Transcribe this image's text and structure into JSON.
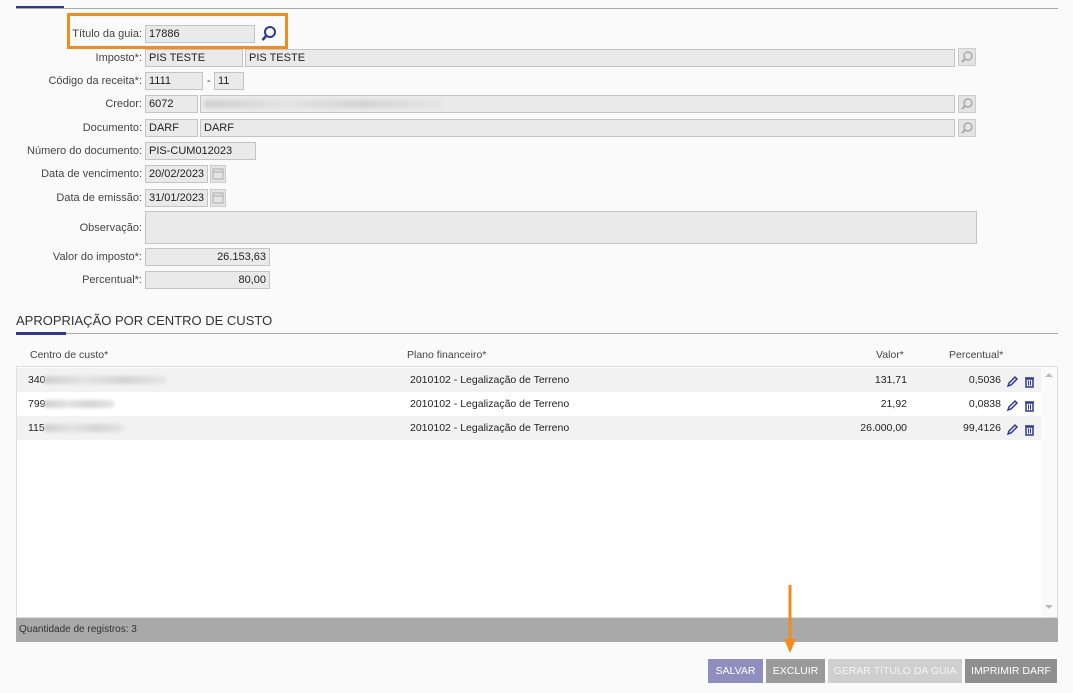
{
  "form": {
    "titulo_label": "Título da guia:",
    "titulo_value": "17886",
    "imposto_label": "Imposto*:",
    "imposto_code": "PIS TESTE",
    "imposto_desc": "PIS TESTE",
    "codigo_label": "Código da receita*:",
    "codigo_value": "1111",
    "codigo_sep": "-",
    "codigo_suffix": "11",
    "credor_label": "Credor:",
    "credor_code": "6072",
    "documento_label": "Documento:",
    "documento_code": "DARF",
    "documento_desc": "DARF",
    "numero_label": "Número do documento:",
    "numero_value": "PIS-CUM012023",
    "vencimento_label": "Data de vencimento:",
    "vencimento_value": "20/02/2023",
    "emissao_label": "Data de emissão:",
    "emissao_value": "31/01/2023",
    "observacao_label": "Observação:",
    "valor_label": "Valor do imposto*:",
    "valor_value": "26.153,63",
    "percentual_label": "Percentual*:",
    "percentual_value": "80,00"
  },
  "section": {
    "title": "APROPRIAÇÃO POR CENTRO DE CUSTO"
  },
  "table": {
    "headers": {
      "centro": "Centro de custo*",
      "plano": "Plano financeiro*",
      "valor": "Valor*",
      "percentual": "Percentual*"
    },
    "rows": [
      {
        "centro": "340",
        "plano": "2010102 - Legalização de Terreno",
        "valor": "131,71",
        "percentual": "0,5036"
      },
      {
        "centro": "799",
        "plano": "2010102 - Legalização de Terreno",
        "valor": "21,92",
        "percentual": "0,0838"
      },
      {
        "centro": "115",
        "plano": "2010102 - Legalização de Terreno",
        "valor": "26.000,00",
        "percentual": "99,4126"
      }
    ],
    "footer": "Quantidade de registros: 3"
  },
  "buttons": {
    "salvar": "SALVAR",
    "excluir": "EXCLUIR",
    "gerar": "GERAR TÍTULO DA GUIA",
    "imprimir": "IMPRIMIR DARF"
  },
  "colors": {
    "accent": "#2f3a8f",
    "highlight": "#f28c1e",
    "salvar": "#8e8ebf",
    "excluir": "#9a9a9a",
    "gerar": "#cfcfcf",
    "imprimir": "#8f8f8f"
  },
  "icons": [
    "search-icon",
    "calendar-icon",
    "edit-icon",
    "trash-icon",
    "arrow-down-icon"
  ]
}
